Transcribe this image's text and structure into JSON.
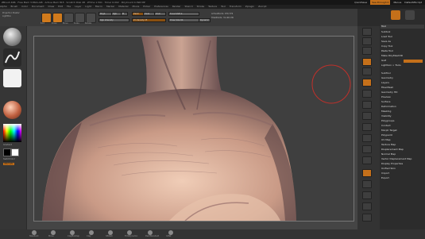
{
  "window": {
    "title": "ZBrush 4R6 · Free Mem 3.862+GB · Active Mem 815 · Scratch Disk 48 · ZTime 1.591 · Timer 0.002 · PolyCount 4.396 MP",
    "quicksave": "QuickSave",
    "see_through": "See-through 0",
    "menus": "Menus",
    "default_script": "DefaultZScript"
  },
  "menubar": [
    "Alpha",
    "Brush",
    "Color",
    "Document",
    "Draw",
    "Edit",
    "File",
    "Layer",
    "Light",
    "Macro",
    "Marker",
    "Material",
    "Movie",
    "Picker",
    "Preferences",
    "Render",
    "Stencil",
    "Stroke",
    "Texture",
    "Tool",
    "Transform",
    "Zplugin",
    "Zscript"
  ],
  "toolbar": {
    "projection_master": "Projection Master",
    "lightbox": "LightBox",
    "edit": "Edit",
    "draw": "Draw",
    "move": "Move",
    "scale": "Scale",
    "rotate": "Rotate",
    "mrgb": "Mrgb",
    "rgb": "Rgb",
    "m": "M",
    "zadd": "Zadd",
    "zsub": "Zsub",
    "zcut": "Zcut",
    "rgb_intensity": "Rgb Intensity",
    "z_intensity": "Z Intensity 25",
    "focal_shift": "Focal Shift 0",
    "draw_size": "Draw Size 64",
    "dynamic": "Dynamic",
    "active_points": "ActivePoints: 979,776",
    "total_points": "TotalPoints: 31.401 Mil"
  },
  "left_shelf": {
    "gradient_label": "Gradient",
    "switch_color_label": "SwitchColor",
    "alternate_label": "Alternate"
  },
  "right_shelf": {
    "buttons": [
      "BPR",
      "SPix 3",
      "Scroll",
      "Zoom",
      "Actual",
      "AAHalf",
      "Persp",
      "Floor",
      "Local",
      "L.Sym",
      "Gxyz",
      "Frame",
      "Move",
      "Scale",
      "Rotate",
      "PolyF",
      "Transp",
      "Ghost",
      "Solo",
      "Xpose"
    ]
  },
  "tray": {
    "header": "Tool",
    "rows": [
      "Subtool",
      "Load Tool",
      "Save As",
      "Copy Tool",
      "Paste Tool",
      "Import",
      "Export",
      "Clone",
      "Make PolyMesh3D",
      "GoZ",
      "All",
      "Visible",
      "R",
      "Lightbox > Tools"
    ],
    "subtool_items": [
      "SubTool",
      "Geometry",
      "Layers",
      "FiberMesh",
      "Geometry HD",
      "Preview",
      "Surface",
      "Deformation",
      "Masking",
      "Visibility",
      "Polygroups",
      "Contact",
      "Morph Target",
      "Polypaint",
      "UV Map",
      "Texture Map",
      "Displacement Map",
      "Normal Map",
      "Vector Displacement Map",
      "Display Properties",
      "Unified Skin",
      "Import",
      "Export"
    ]
  },
  "bottom_shelf": [
    "Standard",
    "Move",
    "ClayBuildup",
    "Clay",
    "hPolish",
    "TrimDynamic",
    "DamStandard",
    "Inflat",
    "Pinch"
  ],
  "colors": {
    "accent": "#d07a1c",
    "background": "#2b2b2b",
    "brush_cursor": "#c0302a"
  }
}
